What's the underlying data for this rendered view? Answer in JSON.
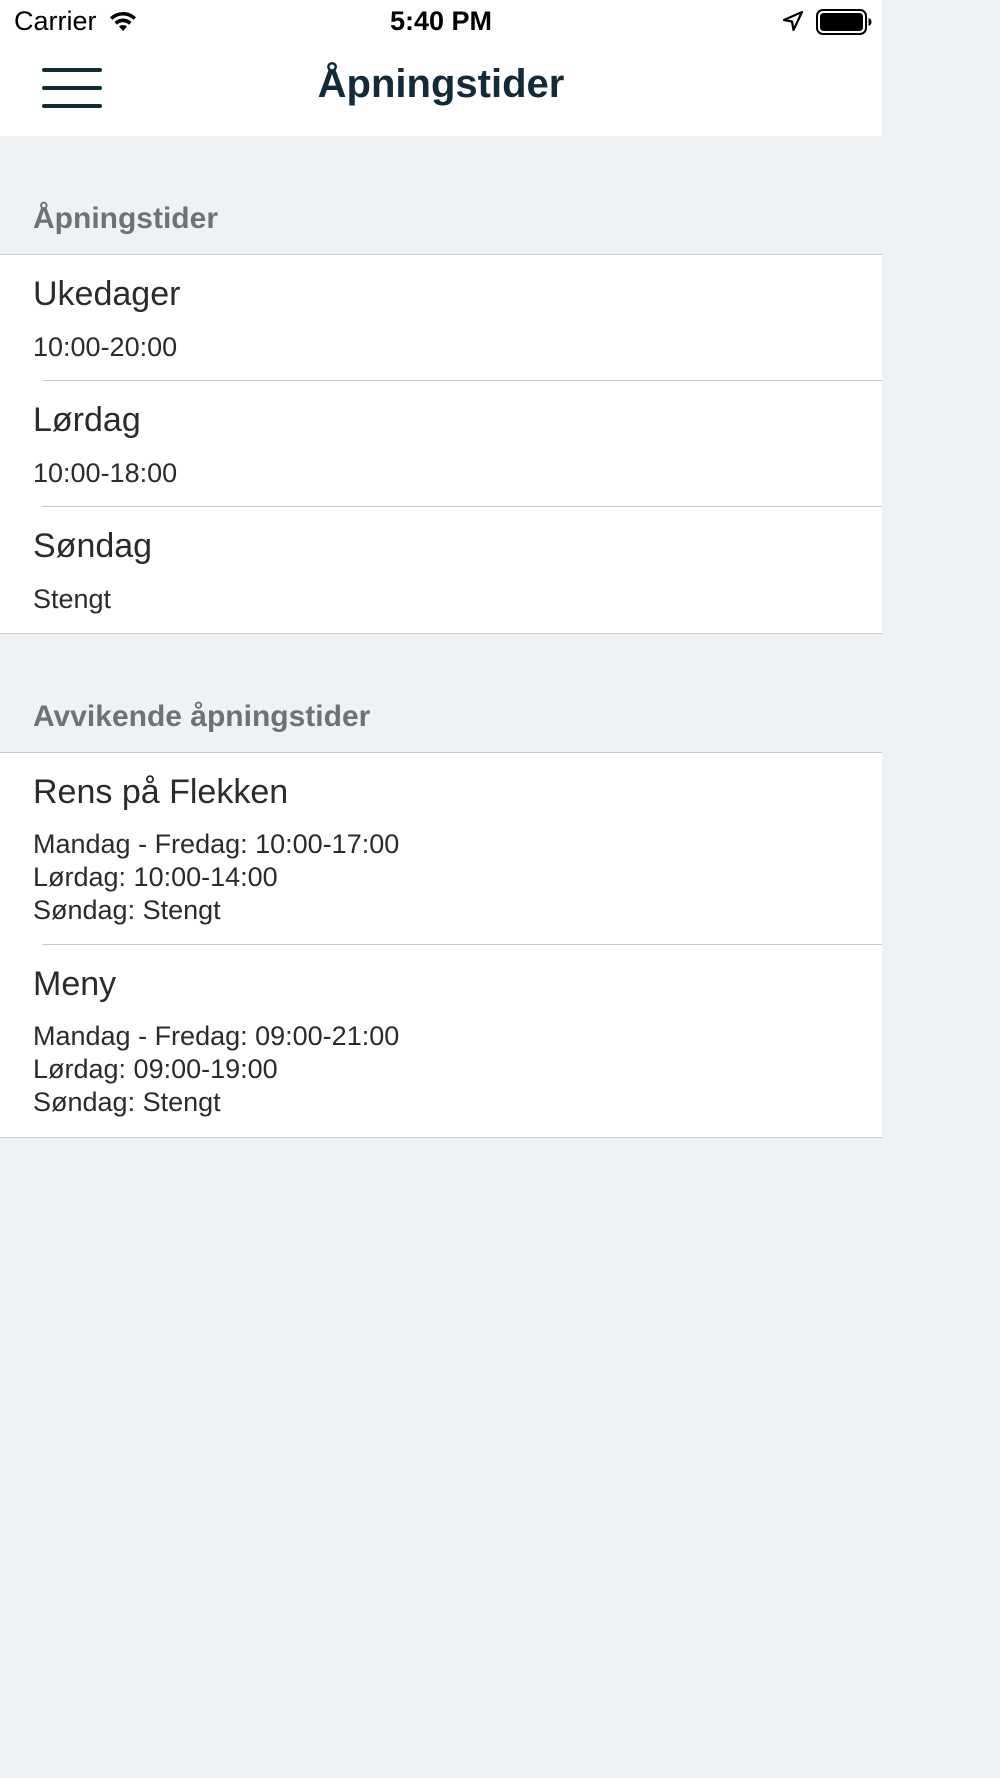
{
  "status_bar": {
    "carrier": "Carrier",
    "time": "5:40 PM",
    "icons": [
      "wifi-icon",
      "location-icon",
      "battery-icon"
    ]
  },
  "nav_bar": {
    "title": "Åpningstider",
    "menu_icon": "hamburger-menu-icon"
  },
  "sections": [
    {
      "header": "Åpningstider",
      "rows": [
        {
          "title": "Ukedager",
          "detail": "10:00-20:00"
        },
        {
          "title": "Lørdag",
          "detail": "10:00-18:00"
        },
        {
          "title": "Søndag",
          "detail": "Stengt"
        }
      ]
    },
    {
      "header": "Avvikende åpningstider",
      "rows": [
        {
          "title": "Rens på Flekken",
          "detail": "Mandag - Fredag: 10:00-17:00\nLørdag: 10:00-14:00\nSøndag: Stengt"
        },
        {
          "title": "Meny",
          "detail": "Mandag - Fredag: 09:00-21:00\nLørdag: 09:00-19:00\nSøndag: Stengt"
        }
      ]
    }
  ],
  "colors": {
    "background": "#eff2f4",
    "nav_title": "#132b38",
    "section_header": "#6e7276",
    "separator": "#c8c8cc"
  }
}
